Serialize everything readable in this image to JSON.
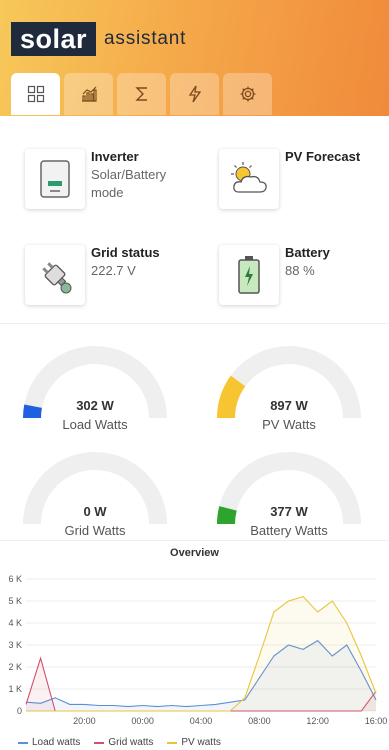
{
  "app": {
    "logo_box": "solar",
    "logo_text": "assistant"
  },
  "tabs": [
    {
      "icon": "dashboard-grid-icon",
      "active": true
    },
    {
      "icon": "chart-icon",
      "active": false
    },
    {
      "icon": "sigma-icon",
      "active": false
    },
    {
      "icon": "lightning-icon",
      "active": false
    },
    {
      "icon": "gear-icon",
      "active": false
    }
  ],
  "cards": {
    "inverter": {
      "title": "Inverter",
      "line1": "Solar/Battery",
      "line2": "mode"
    },
    "pv_forecast": {
      "title": "PV Forecast"
    },
    "grid": {
      "title": "Grid status",
      "value": "222.7 V"
    },
    "battery": {
      "title": "Battery",
      "value": "88 %"
    }
  },
  "gauges": [
    {
      "value": "302 W",
      "label": "Load Watts",
      "fraction": 0.06,
      "color": "#1f5fe0"
    },
    {
      "value": "897 W",
      "label": "PV Watts",
      "fraction": 0.2,
      "color": "#f7c531"
    },
    {
      "value": "0 W",
      "label": "Grid Watts",
      "fraction": 0.0,
      "color": "#d33"
    },
    {
      "value": "377 W",
      "label": "Battery Watts",
      "fraction": 0.08,
      "color": "#2ea42e"
    }
  ],
  "chart_data": {
    "type": "line",
    "title": "Overview",
    "xlabel": "",
    "ylabel": "",
    "ylim": [
      0,
      6000
    ],
    "yticks": [
      "0",
      "1 K",
      "2 K",
      "3 K",
      "4 K",
      "5 K",
      "6 K"
    ],
    "xticks": [
      "20:00",
      "00:00",
      "04:00",
      "08:00",
      "12:00",
      "16:00"
    ],
    "x_hours": [
      16,
      17,
      18,
      19,
      20,
      21,
      22,
      23,
      24,
      25,
      26,
      27,
      28,
      29,
      30,
      31,
      32,
      33,
      34,
      35,
      36,
      37,
      38,
      39,
      40
    ],
    "series": [
      {
        "name": "Load watts",
        "color": "#5b8fd6",
        "values": [
          400,
          350,
          600,
          300,
          300,
          250,
          250,
          200,
          250,
          200,
          250,
          200,
          250,
          300,
          400,
          500,
          1500,
          2500,
          3000,
          2800,
          3200,
          2500,
          3000,
          1800,
          500
        ]
      },
      {
        "name": "Grid watts",
        "color": "#d0506a",
        "values": [
          300,
          2400,
          0,
          0,
          0,
          0,
          0,
          0,
          0,
          0,
          0,
          0,
          0,
          0,
          0,
          0,
          0,
          0,
          0,
          0,
          0,
          0,
          0,
          0,
          900
        ]
      },
      {
        "name": "PV watts",
        "color": "#e8c53a",
        "values": [
          0,
          0,
          0,
          0,
          0,
          0,
          0,
          0,
          0,
          0,
          0,
          0,
          0,
          0,
          0,
          600,
          2500,
          4500,
          5000,
          5200,
          4500,
          5000,
          4000,
          2500,
          800
        ]
      }
    ]
  }
}
